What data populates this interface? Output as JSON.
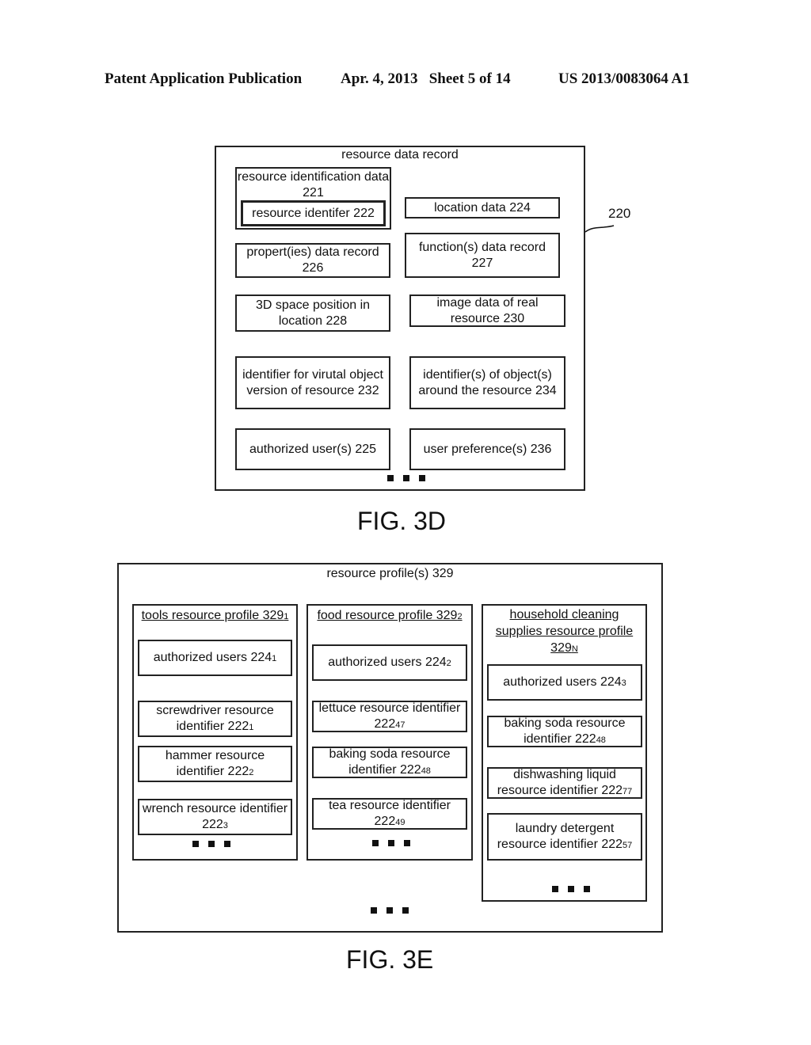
{
  "header": {
    "left": "Patent Application Publication",
    "date_sheet": "Apr. 4, 2013   Sheet 5 of 14",
    "number": "US 2013/0083064 A1"
  },
  "fig3d": {
    "title": "resource data record",
    "ref_label": "220",
    "ident_group": {
      "label": "resource identification data 221",
      "inner": "resource identifer 222"
    },
    "cells": {
      "location": "location data 224",
      "properties": "propert(ies) data record 226",
      "functions": "function(s) data record 227",
      "position": "3D space position in location 228",
      "image": "image data of real resource 230",
      "virtual": "identifier for virutal object version of resource 232",
      "objects": "identifier(s) of object(s) around the resource 234",
      "authorized": "authorized user(s) 225",
      "preferences": "user preference(s) 236"
    },
    "caption": "FIG. 3D"
  },
  "fig3e": {
    "title": "resource profile(s) 329",
    "profiles": [
      {
        "title": "tools resource profile 329",
        "title_sub": "1",
        "items": [
          {
            "text": "authorized users 224",
            "sub": "1"
          },
          {
            "text": "screwdriver resource identifier 222",
            "sub": "1"
          },
          {
            "text": "hammer resource identifier 222",
            "sub": "2"
          },
          {
            "text": "wrench resource identifier 222",
            "sub": "3"
          }
        ]
      },
      {
        "title": "food resource profile 329",
        "title_sub": "2",
        "items": [
          {
            "text": "authorized users 224",
            "sub": "2"
          },
          {
            "text": "lettuce resource identifier 222",
            "sub": "47"
          },
          {
            "text": "baking soda resource identifier 222",
            "sub": "48"
          },
          {
            "text": "tea resource identifier 222",
            "sub": "49"
          }
        ]
      },
      {
        "title": "household cleaning supplies resource profile 329",
        "title_sub": "N",
        "items": [
          {
            "text": "authorized users 224",
            "sub": "3"
          },
          {
            "text": "baking soda resource identifier 222",
            "sub": "48"
          },
          {
            "text": "dishwashing liquid resource identifier 222",
            "sub": "77"
          },
          {
            "text": "laundry detergent resource identifier 222",
            "sub": "57"
          }
        ]
      }
    ],
    "caption": "FIG. 3E"
  }
}
